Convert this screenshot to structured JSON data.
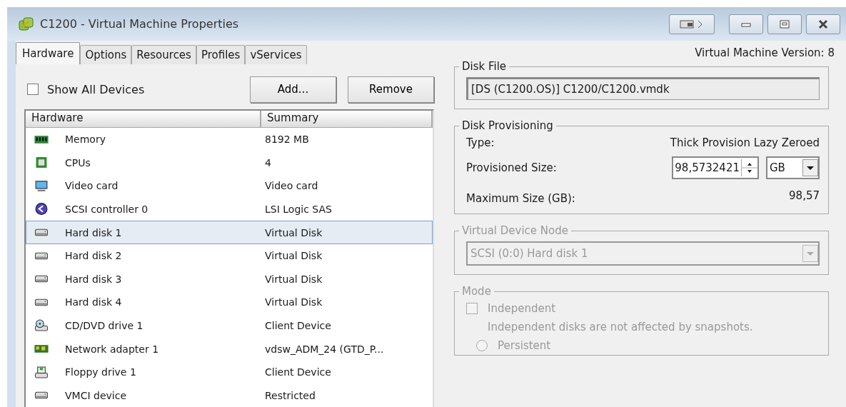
{
  "window": {
    "title": "C1200 - Virtual Machine Properties"
  },
  "tabs": [
    {
      "label": "Hardware",
      "selected": true
    },
    {
      "label": "Options",
      "selected": false
    },
    {
      "label": "Resources",
      "selected": false
    },
    {
      "label": "Profiles",
      "selected": false
    },
    {
      "label": "vServices",
      "selected": false
    }
  ],
  "version_label": "Virtual Machine Version: 8",
  "show_all_devices": {
    "label": "Show All Devices",
    "checked": false
  },
  "buttons": [
    "Add...",
    "Remove"
  ],
  "hardware_table": {
    "columns": [
      "Hardware",
      "Summary"
    ],
    "rows": [
      {
        "kind": "memory",
        "name": "Memory",
        "summary": "8192 MB",
        "selected": false
      },
      {
        "kind": "cpu",
        "name": "CPUs",
        "summary": "4",
        "selected": false
      },
      {
        "kind": "video",
        "name": "Video card",
        "summary": "Video card",
        "selected": false
      },
      {
        "kind": "scsi",
        "name": "SCSI controller 0",
        "summary": "LSI Logic SAS",
        "selected": false
      },
      {
        "kind": "disk",
        "name": "Hard disk 1",
        "summary": "Virtual Disk",
        "selected": true
      },
      {
        "kind": "disk",
        "name": "Hard disk 2",
        "summary": "Virtual Disk",
        "selected": false
      },
      {
        "kind": "disk",
        "name": "Hard disk 3",
        "summary": "Virtual Disk",
        "selected": false
      },
      {
        "kind": "disk",
        "name": "Hard disk 4",
        "summary": "Virtual Disk",
        "selected": false
      },
      {
        "kind": "cdrom",
        "name": "CD/DVD drive 1",
        "summary": "Client Device",
        "selected": false
      },
      {
        "kind": "network",
        "name": "Network adapter 1",
        "summary": "vdsw_ADM_24 (GTD_P...",
        "selected": false
      },
      {
        "kind": "floppy",
        "name": "Floppy drive 1",
        "summary": "Client Device",
        "selected": false
      },
      {
        "kind": "disk",
        "name": "VMCI device",
        "summary": "Restricted",
        "selected": false
      }
    ]
  },
  "disk_file": {
    "legend": "Disk File",
    "value": "[DS (C1200.OS)] C1200/C1200.vmdk"
  },
  "disk_provisioning": {
    "legend": "Disk Provisioning",
    "type_label": "Type:",
    "type_value": "Thick Provision Lazy Zeroed",
    "size_label": "Provisioned Size:",
    "size_value": "98,5732421",
    "unit": "GB",
    "max_label": "Maximum Size (GB):",
    "max_value": "98,57"
  },
  "virtual_device_node": {
    "legend": "Virtual Device Node",
    "value": "SCSI (0:0) Hard disk 1",
    "disabled": true
  },
  "mode": {
    "legend": "Mode",
    "disabled": true,
    "independent": {
      "label": "Independent",
      "checked": false
    },
    "note": "Independent disks are not affected by snapshots.",
    "persistent": {
      "label": "Persistent",
      "selected": false
    }
  }
}
